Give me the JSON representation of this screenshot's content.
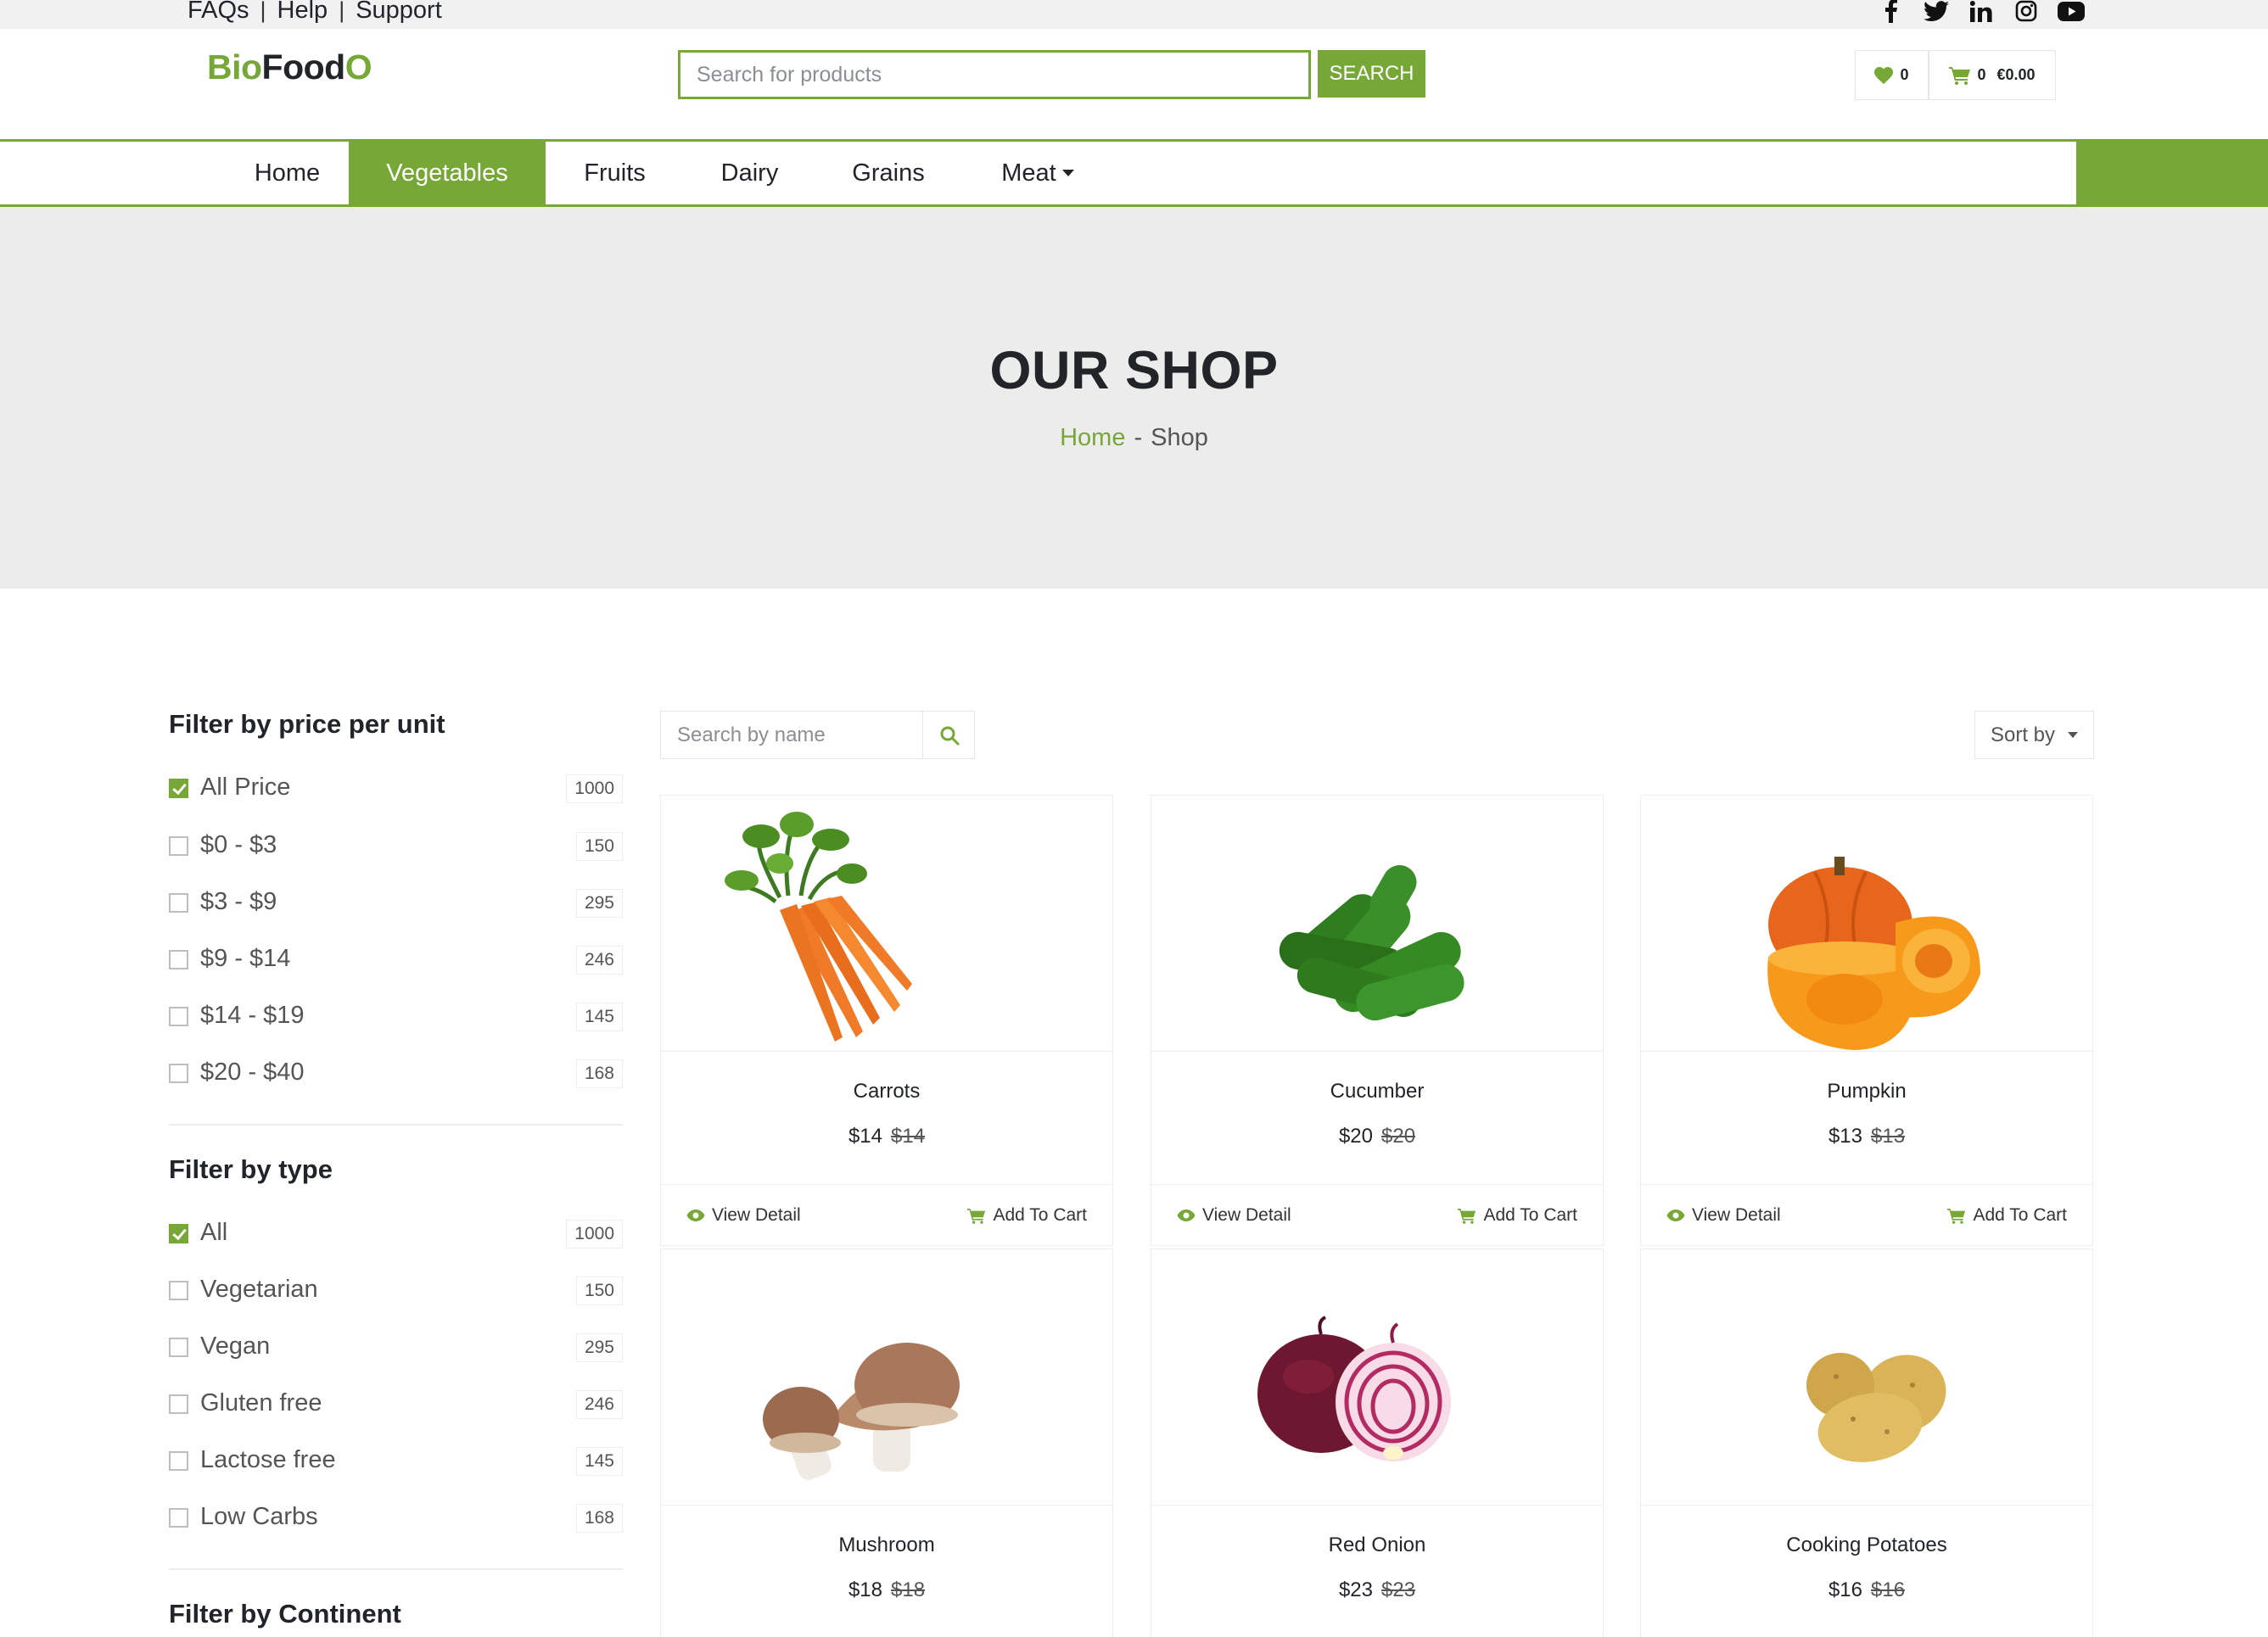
{
  "topbar": {
    "links": [
      "FAQs",
      "Help",
      "Support"
    ],
    "social_icons": [
      "facebook-icon",
      "twitter-icon",
      "linkedin-icon",
      "instagram-icon",
      "youtube-icon"
    ]
  },
  "header": {
    "logo": {
      "part1": "Bio",
      "part2": "Food",
      "part3": "O"
    },
    "search_placeholder": "Search for products",
    "search_button": "SEARCH",
    "wishlist_count": "0",
    "cart_count": "0",
    "cart_total": "€0.00"
  },
  "nav": {
    "items": [
      "Home",
      "Vegetables",
      "Fruits",
      "Dairy",
      "Grains",
      "Meat"
    ],
    "active": "Vegetables"
  },
  "hero": {
    "title": "OUR SHOP",
    "breadcrumb_home": "Home",
    "breadcrumb_sep": "-",
    "breadcrumb_current": "Shop"
  },
  "filters": {
    "price": {
      "title": "Filter by price per unit",
      "options": [
        {
          "label": "All Price",
          "count": "1000",
          "checked": true
        },
        {
          "label": "$0 - $3",
          "count": "150",
          "checked": false
        },
        {
          "label": "$3 - $9",
          "count": "295",
          "checked": false
        },
        {
          "label": "$9 - $14",
          "count": "246",
          "checked": false
        },
        {
          "label": "$14 - $19",
          "count": "145",
          "checked": false
        },
        {
          "label": "$20 - $40",
          "count": "168",
          "checked": false
        }
      ]
    },
    "type": {
      "title": "Filter by type",
      "options": [
        {
          "label": "All",
          "count": "1000",
          "checked": true
        },
        {
          "label": "Vegetarian",
          "count": "150",
          "checked": false
        },
        {
          "label": "Vegan",
          "count": "295",
          "checked": false
        },
        {
          "label": "Gluten free",
          "count": "246",
          "checked": false
        },
        {
          "label": "Lactose free",
          "count": "145",
          "checked": false
        },
        {
          "label": "Low Carbs",
          "count": "168",
          "checked": false
        }
      ]
    },
    "continent": {
      "title": "Filter by Continent"
    }
  },
  "toolbar": {
    "search_placeholder": "Search by name",
    "sort_label": "Sort by"
  },
  "products": [
    {
      "name": "Carrots",
      "price": "$14",
      "old_price": "$14",
      "image": "carrots"
    },
    {
      "name": "Cucumber",
      "price": "$20",
      "old_price": "$20",
      "image": "cucumber"
    },
    {
      "name": "Pumpkin",
      "price": "$13",
      "old_price": "$13",
      "image": "pumpkin"
    },
    {
      "name": "Mushroom",
      "price": "$18",
      "old_price": "$18",
      "image": "mushroom"
    },
    {
      "name": "Red Onion",
      "price": "$23",
      "old_price": "$23",
      "image": "red-onion"
    },
    {
      "name": "Cooking Potatoes",
      "price": "$16",
      "old_price": "$16",
      "image": "potatoes"
    }
  ],
  "card_actions": {
    "view": "View Detail",
    "cart": "Add To Cart"
  },
  "colors": {
    "accent": "#76a737",
    "hero_bg": "#ececec",
    "topbar_bg": "#f1f1f1"
  }
}
